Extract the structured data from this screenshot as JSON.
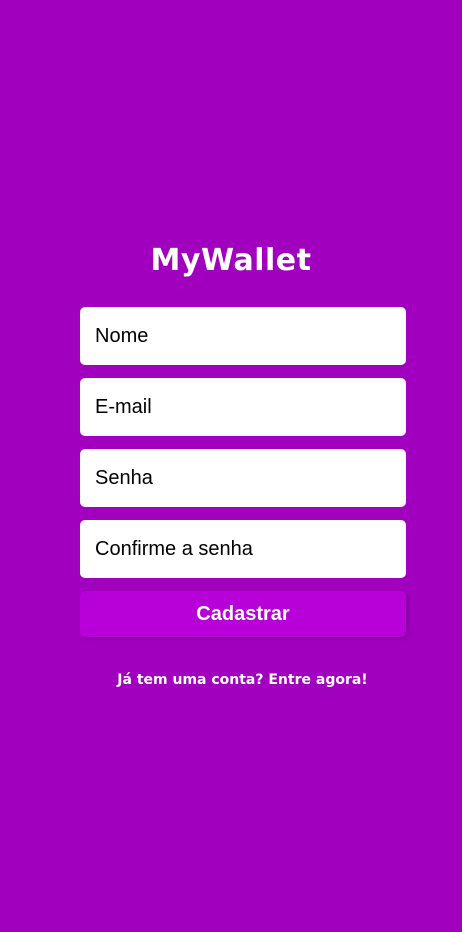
{
  "app": {
    "logo_text": "MyWallet"
  },
  "form": {
    "name_placeholder": "Nome",
    "email_placeholder": "E-mail",
    "password_placeholder": "Senha",
    "confirm_password_placeholder": "Confirme a senha",
    "submit_label": "Cadastrar"
  },
  "footer": {
    "signin_link": "Já tem uma conta? Entre agora!"
  },
  "colors": {
    "background": "#a100be",
    "button": "#b800d8",
    "text_light": "#ffffff",
    "input_background": "#ffffff"
  }
}
